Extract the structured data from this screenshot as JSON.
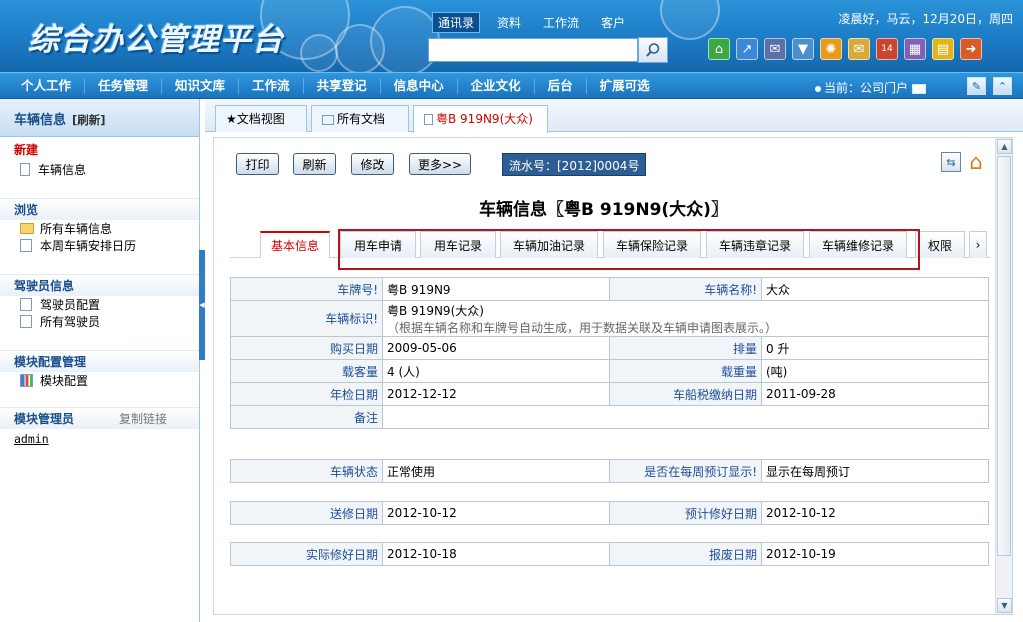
{
  "header": {
    "logo": "综合办公管理平台",
    "top_links": [
      "通讯录",
      "资料",
      "工作流",
      "客户"
    ],
    "search_value": "",
    "greeting": "凌晨好，马云，12月20日，周四",
    "tool_icons": [
      "home-icon",
      "refresh-icon",
      "mail-icon",
      "shirt-icon",
      "sun-icon",
      "envelope-icon",
      "calendar-icon",
      "chart-icon",
      "note-icon",
      "logout-icon"
    ]
  },
  "menu": {
    "items": [
      "个人工作",
      "任务管理",
      "知识文库",
      "工作流",
      "共享登记",
      "信息中心",
      "企业文化",
      "后台",
      "扩展可选"
    ],
    "current": "当前：公司门户"
  },
  "sidebar": {
    "title": "车辆信息",
    "refresh": "[刷新]",
    "new_title": "新建",
    "new_items": [
      "车辆信息"
    ],
    "browse_title": "浏览",
    "browse_items": [
      "所有车辆信息",
      "本周车辆安排日历"
    ],
    "driver_title": "驾驶员信息",
    "driver_items": [
      "驾驶员配置",
      "所有驾驶员"
    ],
    "module_title": "模块配置管理",
    "module_items": [
      "模块配置"
    ],
    "admin_title": "模块管理员",
    "admin_link": "复制链接",
    "admin_user": "admin"
  },
  "doc_tabs": [
    "★文档视图",
    "所有文档",
    "粤B 919N9(大众)"
  ],
  "toolbar": {
    "print": "打印",
    "refresh": "刷新",
    "edit": "修改",
    "more": "更多>>",
    "serial": "流水号：[2012]0004号"
  },
  "record_title": "车辆信息〖粤B 919N9(大众)〗",
  "record_tabs": [
    "基本信息",
    "用车申请",
    "用车记录",
    "车辆加油记录",
    "车辆保险记录",
    "车辆违章记录",
    "车辆维修记录",
    "权限"
  ],
  "fields": {
    "plate_label": "车牌号!",
    "plate": "粤B 919N9",
    "name_label": "车辆名称!",
    "name": "大众",
    "id_label": "车辆标识!",
    "id": "粤B 919N9(大众)",
    "id_hint": "（根据车辆名称和车牌号自动生成，用于数据关联及车辆申请图表展示。）",
    "buy_label": "购买日期",
    "buy": "2009-05-06",
    "disp_label": "排量",
    "disp": "0 升",
    "seats_label": "载客量",
    "seats": "4 (人)",
    "load_label": "载重量",
    "load": "(吨)",
    "inspect_label": "年检日期",
    "inspect": "2012-12-12",
    "tax_label": "车船税缴纳日期",
    "tax": "2011-09-28",
    "note_label": "备注",
    "note": "",
    "status_label": "车辆状态",
    "status": "正常使用",
    "weekly_label": "是否在每周预订显示!",
    "weekly": "显示在每周预订",
    "repair_label": "送修日期",
    "repair": "2012-10-12",
    "expected_label": "预计修好日期",
    "expected": "2012-10-12",
    "actual_label": "实际修好日期",
    "actual": "2012-10-18",
    "scrap_label": "报废日期",
    "scrap": "2012-10-19"
  }
}
